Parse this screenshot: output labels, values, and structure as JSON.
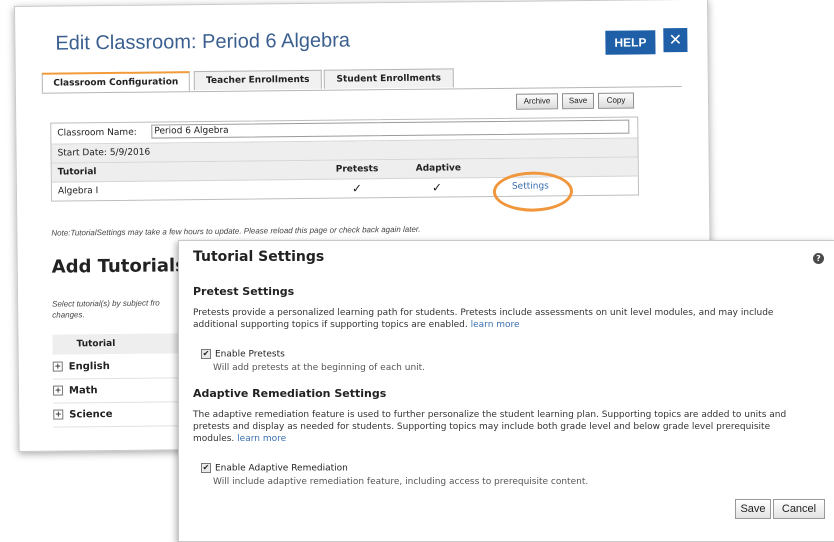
{
  "edit_window": {
    "title": "Edit Classroom: Period 6 Algebra",
    "help_label": "HELP",
    "close_label": "✕",
    "tabs": [
      {
        "label": "Classroom Configuration"
      },
      {
        "label": "Teacher Enrollments"
      },
      {
        "label": "Student Enrollments"
      }
    ],
    "buttons": {
      "archive": "Archive",
      "save": "Save",
      "copy": "Copy"
    },
    "classroom_name_label": "Classroom Name:",
    "classroom_name_value": "Period 6 Algebra",
    "start_date": "Start Date: 5/9/2016",
    "table": {
      "headers": [
        "Tutorial",
        "Pretests",
        "Adaptive"
      ],
      "rows": [
        {
          "tutorial": "Algebra I",
          "pretests": "✓",
          "adaptive": "✓",
          "settings": "Settings"
        }
      ]
    },
    "note": "Note:TutorialSettings may take a few hours to update. Please reload this page or check back again later.",
    "add_tutorials_heading": "Add Tutorials f",
    "select_text": "Select tutorial(s) by subject fro changes.",
    "tutorial_column": "Tutorial",
    "subjects": [
      "English",
      "Math",
      "Science"
    ]
  },
  "dialog": {
    "title": "Tutorial Settings",
    "help_icon": "?",
    "pretest_heading": "Pretest Settings",
    "pretest_desc": "Pretests provide a personalized learning path for students. Pretests include assessments on unit level modules, and may include additional supporting topics if supporting topics are enabled.",
    "learn_more": "learn more",
    "enable_pretests_label": "Enable Pretests",
    "enable_pretests_checked": true,
    "enable_pretests_sub": "Will add pretests at the beginning of each unit.",
    "adaptive_heading": "Adaptive Remediation Settings",
    "adaptive_desc": "The adaptive remediation feature is used to further personalize the student learning plan. Supporting topics are added to units and pretests and display as needed for students. Supporting topics may include both grade level and below grade level prerequisite modules.",
    "enable_adaptive_label": "Enable Adaptive Remediation",
    "enable_adaptive_checked": true,
    "enable_adaptive_sub": "Will include adaptive remediation feature, including access to prerequisite content.",
    "save_label": "Save",
    "cancel_label": "Cancel"
  },
  "colors": {
    "accent": "#1e5fa8",
    "highlight": "#f0963c",
    "link": "#3a6fb0"
  }
}
